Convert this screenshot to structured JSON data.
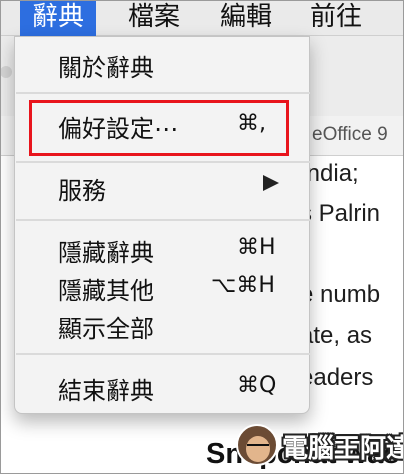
{
  "menubar": {
    "items": [
      {
        "label": "辭典",
        "active": true
      },
      {
        "label": "檔案",
        "active": false
      },
      {
        "label": "編輯",
        "active": false
      },
      {
        "label": "前往",
        "active": false
      }
    ],
    "accent_color": "#2d6ee0"
  },
  "menu": {
    "about": "關於辭典",
    "preferences": {
      "label": "偏好設定⋯",
      "shortcut": "⌘,"
    },
    "services": {
      "label": "服務",
      "arrow_icon": "submenu-arrow-icon"
    },
    "hide": {
      "label": "隱藏辭典",
      "shortcut": "⌘H"
    },
    "hide_others": {
      "label": "隱藏其他",
      "shortcut": "⌥⌘H"
    },
    "show_all": "顯示全部",
    "quit": {
      "label": "結束辭典",
      "shortcut": "⌘Q"
    },
    "highlight_color": "#e8141c"
  },
  "background": {
    "tab_text": "eOffice 9",
    "lines": [
      "India;",
      "s Palrin",
      "e numb",
      "ate, as",
      "eaders"
    ],
    "heading": "Snapchat was"
  },
  "watermark": {
    "text": "電腦王阿達"
  }
}
